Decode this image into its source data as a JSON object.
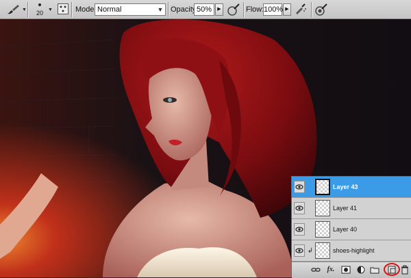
{
  "options_bar": {
    "tool": "brush-icon",
    "brush_size": "20",
    "mode_label": "Mode:",
    "mode_value": "Normal",
    "opacity_label": "Opacity:",
    "opacity_value": "50%",
    "flow_label": "Flow:",
    "flow_value": "100%"
  },
  "layers_panel": {
    "layers": [
      {
        "name": "Layer 43",
        "selected": true
      },
      {
        "name": "Layer 41",
        "selected": false
      },
      {
        "name": "Layer 40",
        "selected": false
      },
      {
        "name": "shoes-highlight",
        "selected": false
      }
    ],
    "footer_icons": [
      "link-icon",
      "fx-icon",
      "mask-icon",
      "adjustment-icon",
      "group-icon",
      "new-layer-icon",
      "trash-icon"
    ],
    "footer_fx": "fx.",
    "highlight_color": "#e01010",
    "selection_color": "#3c9be6"
  }
}
